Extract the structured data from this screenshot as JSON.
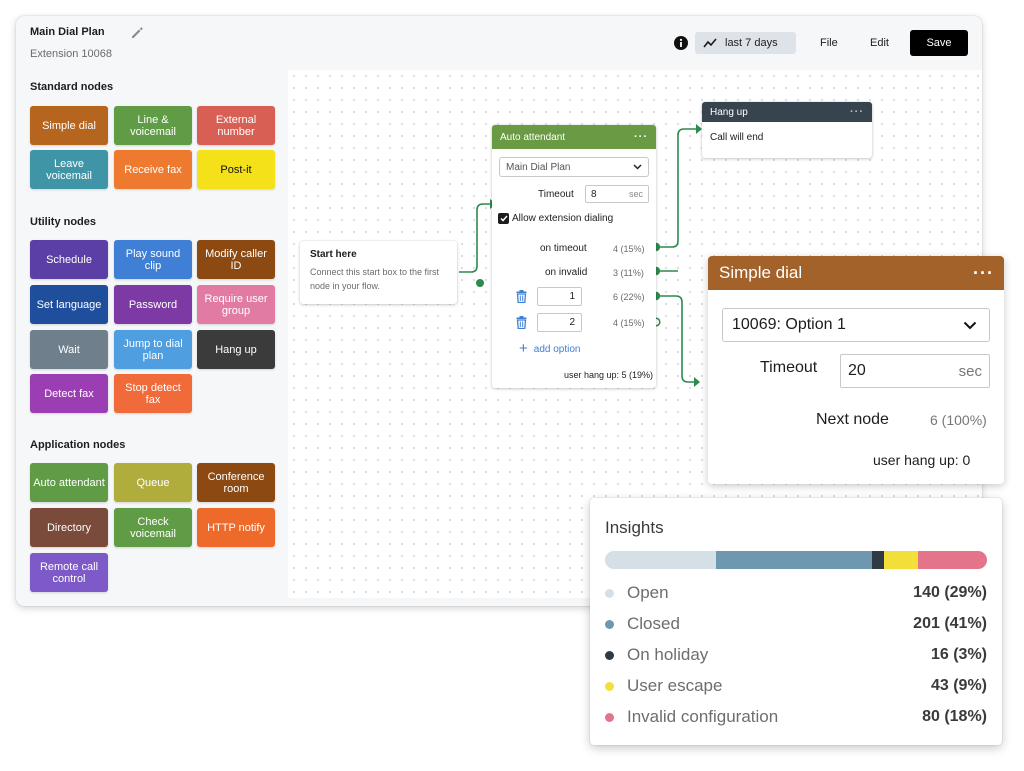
{
  "header": {
    "plan_name": "Main Dial Plan",
    "extension": "Extension 10068",
    "range_label": "last 7 days",
    "file_label": "File",
    "edit_label": "Edit",
    "save_label": "Save"
  },
  "palette": {
    "standard_title": "Standard nodes",
    "standard": [
      {
        "label": "Simple dial",
        "color": "#b5651d"
      },
      {
        "label": "Line & voicemail",
        "color": "#5f9c45"
      },
      {
        "label": "External number",
        "color": "#d75f53"
      },
      {
        "label": "Leave voicemail",
        "color": "#3f94a6"
      },
      {
        "label": "Receive fax",
        "color": "#ee7a30"
      },
      {
        "label": "Post-it",
        "color": "#f5e11a"
      }
    ],
    "utility_title": "Utility nodes",
    "utility": [
      {
        "label": "Schedule",
        "color": "#5b3ea6"
      },
      {
        "label": "Play sound clip",
        "color": "#3f7fd6"
      },
      {
        "label": "Modify caller ID",
        "color": "#8c4a12"
      },
      {
        "label": "Set language",
        "color": "#1f4e9c"
      },
      {
        "label": "Password",
        "color": "#7d3aa5"
      },
      {
        "label": "Require user group",
        "color": "#e27ba4"
      },
      {
        "label": "Wait",
        "color": "#6f7f8c"
      },
      {
        "label": "Jump to dial plan",
        "color": "#4f9fe0"
      },
      {
        "label": "Hang up",
        "color": "#3b3b3b"
      },
      {
        "label": "Detect fax",
        "color": "#9b3eb3"
      },
      {
        "label": "Stop detect fax",
        "color": "#f06a3a"
      }
    ],
    "application_title": "Application nodes",
    "application": [
      {
        "label": "Auto attendant",
        "color": "#5f9c45"
      },
      {
        "label": "Queue",
        "color": "#b1ad3d"
      },
      {
        "label": "Conference room",
        "color": "#8c4a12"
      },
      {
        "label": "Directory",
        "color": "#7a4a3a"
      },
      {
        "label": "Check voicemail",
        "color": "#5f9c45"
      },
      {
        "label": "HTTP notify",
        "color": "#ee6a2a"
      },
      {
        "label": "Remote call control",
        "color": "#7d5ac8"
      }
    ]
  },
  "start_node": {
    "title": "Start here",
    "description": "Connect this start box to the first node in your flow."
  },
  "auto_attendant": {
    "title": "Auto attendant",
    "dial_plan": "Main Dial Plan",
    "timeout_label": "Timeout",
    "timeout_value": "8",
    "timeout_unit": "sec",
    "allow_ext_label": "Allow extension dialing",
    "on_timeout_label": "on timeout",
    "on_timeout_count": "4 (15%)",
    "on_invalid_label": "on invalid",
    "on_invalid_count": "3 (11%)",
    "options": [
      {
        "value": "1",
        "count": "6 (22%)"
      },
      {
        "value": "2",
        "count": "4 (15%)"
      }
    ],
    "add_option_label": "add option",
    "hang_up_stat": "user hang up: 5 (19%)"
  },
  "hang_up_node": {
    "title": "Hang up",
    "body": "Call will end"
  },
  "simple_dial": {
    "title": "Simple dial",
    "target": "10069: Option 1",
    "timeout_label": "Timeout",
    "timeout_value": "20",
    "timeout_unit": "sec",
    "next_label": "Next node",
    "next_count": "6 (100%)",
    "hang_up_stat": "user hang up: 0"
  },
  "insights": {
    "title": "Insights",
    "items": [
      {
        "label": "Open",
        "value": "140 (29%)",
        "share": 29,
        "color": "#d5dfe6"
      },
      {
        "label": "Closed",
        "value": "201 (41%)",
        "share": 41,
        "color": "#6e97b0"
      },
      {
        "label": "On holiday",
        "value": "16 (3%)",
        "share": 3,
        "color": "#2f3a44"
      },
      {
        "label": "User escape",
        "value": "43 (9%)",
        "share": 9,
        "color": "#f3df3a"
      },
      {
        "label": "Invalid configuration",
        "value": "80 (18%)",
        "share": 18,
        "color": "#e37489"
      }
    ]
  }
}
